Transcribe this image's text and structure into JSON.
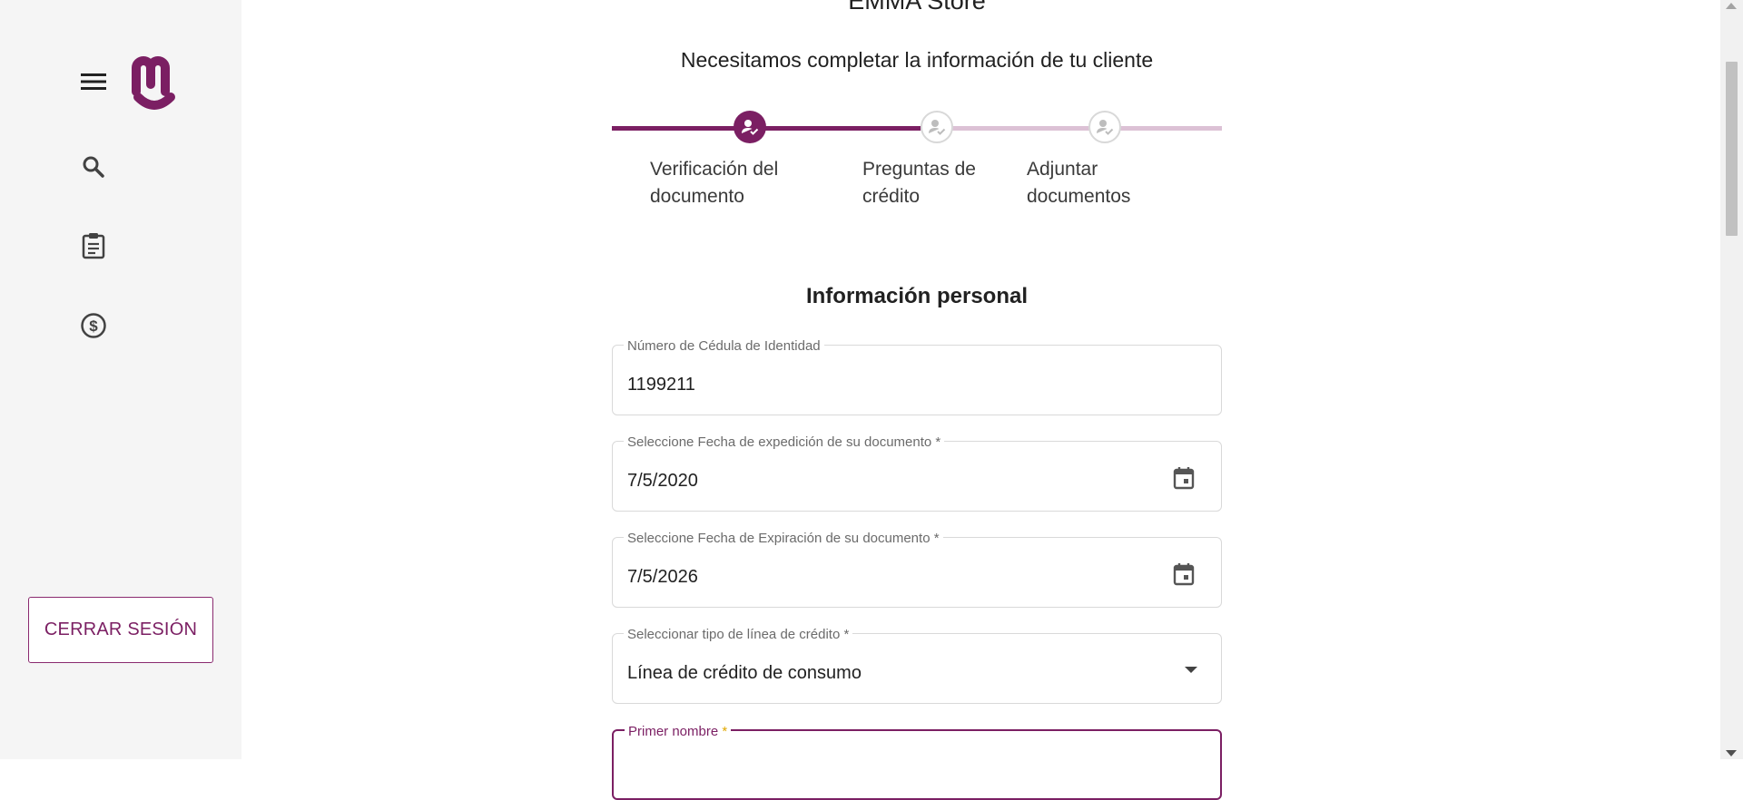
{
  "app": {
    "store_name": "EMMA Store",
    "subtitle": "Necesitamos completar la información de tu cliente"
  },
  "sidebar": {
    "icons": [
      "menu-icon",
      "emma-logo",
      "search-icon",
      "clipboard-icon",
      "dollar-circle-icon"
    ],
    "logout_label": "CERRAR SESIÓN"
  },
  "stepper": {
    "progress": 0.5,
    "steps": [
      {
        "label": "Verificación del documento",
        "status": "active"
      },
      {
        "label": "Preguntas de crédito",
        "status": "inactive"
      },
      {
        "label": "Adjuntar documentos",
        "status": "inactive"
      }
    ]
  },
  "form": {
    "section_title": "Información personal",
    "fields": {
      "cedula": {
        "label": "Número de Cédula de Identidad",
        "value": "1199211"
      },
      "issue_date": {
        "label": "Seleccione Fecha de expedición de su documento *",
        "value": "7/5/2020"
      },
      "expiry_date": {
        "label": "Seleccione Fecha de Expiración de su documento *",
        "value": "7/5/2026"
      },
      "credit_line": {
        "label": "Seleccionar tipo de línea de crédito *",
        "value": "Línea de crédito de consumo"
      },
      "first_name": {
        "label": "Primer nombre",
        "required_mark": "*",
        "value": ""
      }
    }
  },
  "colors": {
    "brand": "#7b1f63",
    "brand_light": "#dcc1d5",
    "sidebar_bg": "#f5f5f5",
    "required_star": "#e0a800"
  }
}
